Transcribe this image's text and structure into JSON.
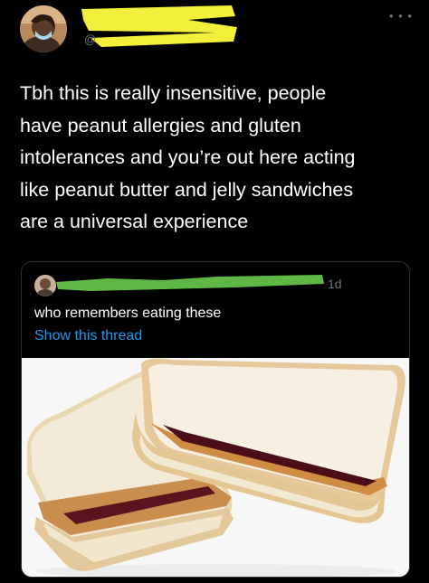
{
  "tweet": {
    "handle_prefix": "@",
    "more_icon": "more-horizontal-icon",
    "text": "Tbh this is really insensitive, people\nhave peanut allergies and gluten\nintolerances and you’re out here acting\nlike peanut butter and jelly sandwiches\nare a universal experience"
  },
  "quoted_tweet": {
    "timestamp": "1d",
    "text": "who remembers eating these",
    "show_thread": "Show this thread",
    "media_subject": "peanut-butter-and-jelly-sandwich"
  },
  "colors": {
    "background": "#000000",
    "text": "#ffffff",
    "secondary_text": "#6e767d",
    "link": "#1d9bf0",
    "border": "#2f3336",
    "redaction_yellow": "#f3ef3a",
    "redaction_green": "#5fb845"
  }
}
